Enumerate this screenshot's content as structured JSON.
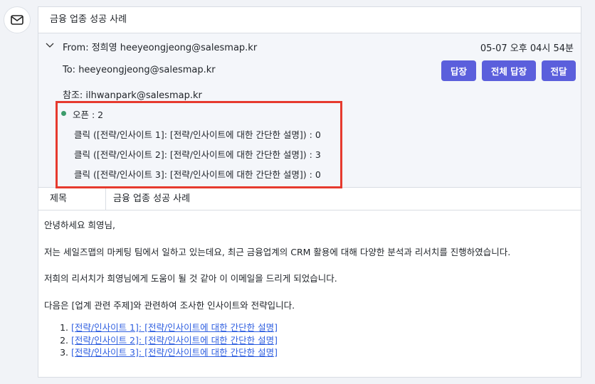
{
  "title": "금융 업종 성공 사례",
  "from": "From: 정희영 heeyeongjeong@salesmap.kr",
  "to": "To: heeyeongjeong@salesmap.kr",
  "cc": "참조: ilhwanpark@salesmap.kr",
  "date": "05-07 오후 04시 54분",
  "buttons": {
    "reply": "답장",
    "reply_all": "전체 답장",
    "forward": "전달"
  },
  "stats": [
    "오픈 : 2",
    "클릭 ([전략/인사이트 1]: [전략/인사이트에 대한 간단한 설명]) : 0",
    "클릭 ([전략/인사이트 2]: [전략/인사이트에 대한 간단한 설명]) : 3",
    "클릭 ([전략/인사이트 3]: [전략/인사이트에 대한 간단한 설명]) : 0"
  ],
  "subject_label": "제목",
  "subject": "금융 업종 성공 사례",
  "body": {
    "paragraphs": [
      "안녕하세요 희영님,",
      "저는 세일즈맵의 마케팅 팀에서 일하고 있는데요, 최근 금융업계의 CRM 활용에 대해 다양한 분석과 리서치를 진행하였습니다.",
      "저희의 리서치가 희영님에게 도움이 될 것 같아 이 이메일을 드리게 되었습니다.",
      "다음은 [업계 관련 주제]와 관련하여 조사한 인사이트와 전략입니다."
    ],
    "links": [
      "[전략/인사이트 1]: [전략/인사이트에 대한 간단한 설명]",
      "[전략/인사이트 2]: [전략/인사이트에 대한 간단한 설명]",
      "[전략/인사이트 3]: [전략/인사이트에 대한 간단한 설명]"
    ]
  }
}
